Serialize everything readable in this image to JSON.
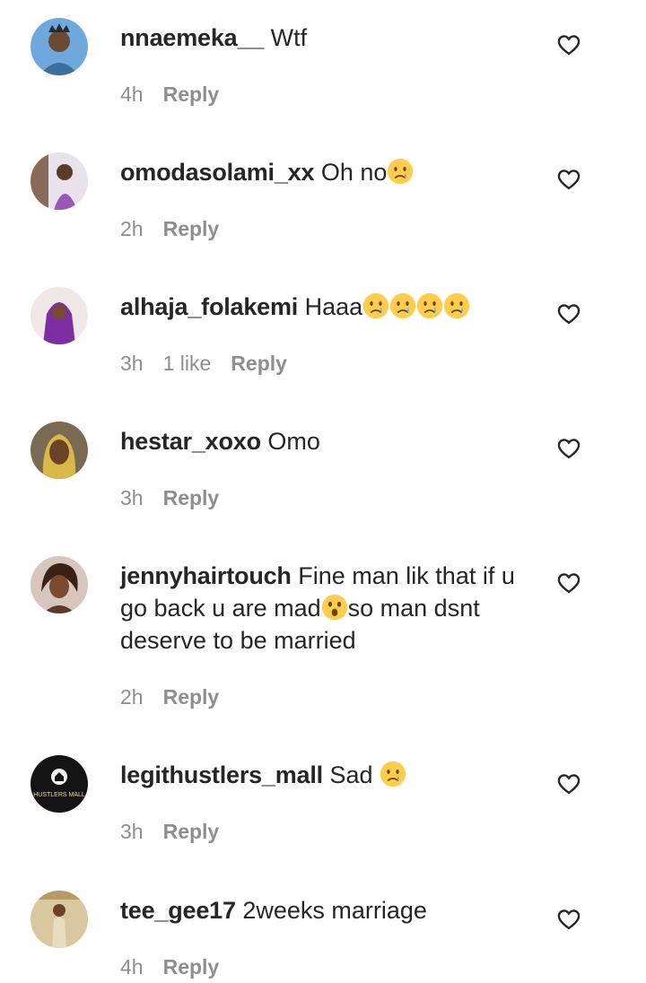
{
  "comments": [
    {
      "username": "nnaemeka__",
      "text": "Wtf",
      "emojis": [],
      "text_after": "",
      "time": "4h",
      "likes": "",
      "reply_label": "Reply"
    },
    {
      "username": "omodasolami_xx",
      "text": "Oh no",
      "emojis": [
        "crying-face"
      ],
      "text_after": "",
      "time": "2h",
      "likes": "",
      "reply_label": "Reply"
    },
    {
      "username": "alhaja_folakemi",
      "text": "Haaa",
      "emojis": [
        "crying-face",
        "crying-face",
        "crying-face",
        "crying-face"
      ],
      "text_after": "",
      "time": "3h",
      "likes": "1 like",
      "reply_label": "Reply"
    },
    {
      "username": "hestar_xoxo",
      "text": "Omo",
      "emojis": [],
      "text_after": "",
      "time": "3h",
      "likes": "",
      "reply_label": "Reply"
    },
    {
      "username": "jennyhairtouch",
      "text": "Fine man lik that if u go back u are mad",
      "emojis": [
        "astonished-face"
      ],
      "text_after": "so man dsnt deserve to be married",
      "time": "2h",
      "likes": "",
      "reply_label": "Reply"
    },
    {
      "username": "legithustlers_mall",
      "text": "Sad ",
      "emojis": [
        "crying-face"
      ],
      "text_after": "",
      "time": "3h",
      "likes": "",
      "reply_label": "Reply"
    },
    {
      "username": "tee_gee17",
      "text": "2weeks marriage",
      "emojis": [],
      "text_after": "",
      "time": "4h",
      "likes": "",
      "reply_label": "Reply"
    }
  ],
  "avatar_logo_text": "HUSTLERS MALL",
  "colors": {
    "text": "#262626",
    "meta": "#8e8e8e",
    "emoji_face": "#ffcc4d",
    "tear": "#5dadec"
  },
  "icons": {
    "like": "heart-outline-icon"
  }
}
